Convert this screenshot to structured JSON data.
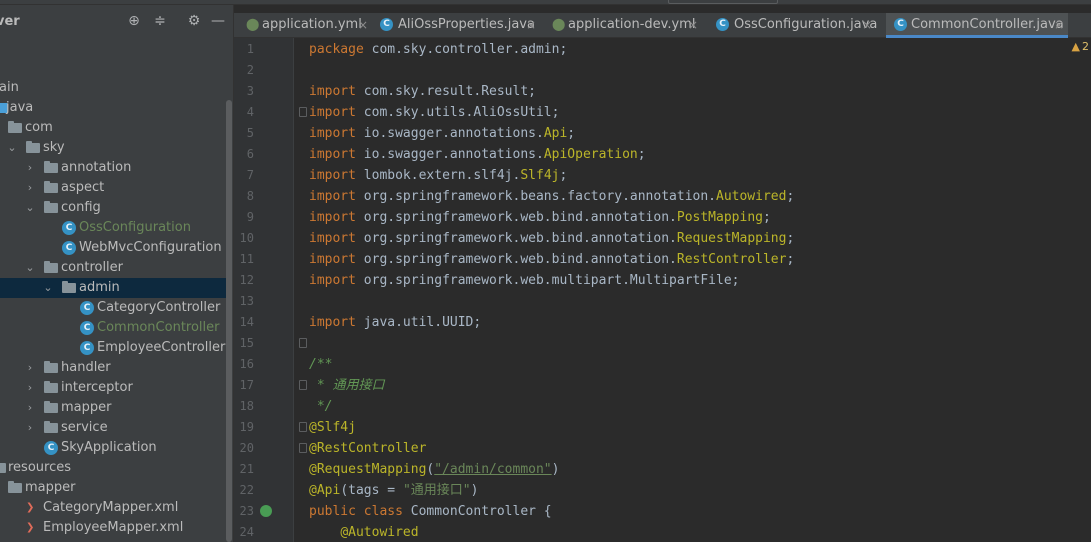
{
  "sidebar": {
    "title": "ver",
    "tree": [
      {
        "label": "ain"
      },
      {
        "label": "java"
      },
      {
        "label": "com"
      },
      {
        "label": "sky"
      },
      {
        "label": "annotation"
      },
      {
        "label": "aspect"
      },
      {
        "label": "config"
      },
      {
        "label": "OssConfiguration"
      },
      {
        "label": "WebMvcConfiguration"
      },
      {
        "label": "controller"
      },
      {
        "label": "admin"
      },
      {
        "label": "CategoryController"
      },
      {
        "label": "CommonController"
      },
      {
        "label": "EmployeeController"
      },
      {
        "label": "handler"
      },
      {
        "label": "interceptor"
      },
      {
        "label": "mapper"
      },
      {
        "label": "service"
      },
      {
        "label": "SkyApplication"
      },
      {
        "label": "resources"
      },
      {
        "label": "mapper"
      },
      {
        "label": "CategoryMapper.xml"
      },
      {
        "label": "EmployeeMapper.xml"
      }
    ]
  },
  "tabs": [
    {
      "label": "application.yml",
      "icon": "yml-icon"
    },
    {
      "label": "AliOssProperties.java",
      "icon": "class-icon"
    },
    {
      "label": "application-dev.yml",
      "icon": "yml-icon"
    },
    {
      "label": "OssConfiguration.java",
      "icon": "class-icon"
    },
    {
      "label": "CommonController.java",
      "icon": "class-icon",
      "active": true
    }
  ],
  "editor": {
    "warning_count": "2",
    "lines": [
      {
        "n": "1",
        "tokens": [
          [
            "kw",
            "package "
          ],
          [
            "p",
            "com.sky.controller.admin;"
          ]
        ]
      },
      {
        "n": "2",
        "tokens": []
      },
      {
        "n": "3",
        "tokens": [
          [
            "kw",
            "import "
          ],
          [
            "p",
            "com.sky.result.Result;"
          ]
        ]
      },
      {
        "n": "4",
        "tokens": [
          [
            "kw",
            "import "
          ],
          [
            "p",
            "com.sky.utils.AliOssUtil;"
          ]
        ]
      },
      {
        "n": "5",
        "tokens": [
          [
            "kw",
            "import "
          ],
          [
            "p",
            "io.swagger.annotations."
          ],
          [
            "ann",
            "Api"
          ],
          [
            "p",
            ";"
          ]
        ]
      },
      {
        "n": "6",
        "tokens": [
          [
            "kw",
            "import "
          ],
          [
            "p",
            "io.swagger.annotations."
          ],
          [
            "ann",
            "ApiOperation"
          ],
          [
            "p",
            ";"
          ]
        ]
      },
      {
        "n": "7",
        "tokens": [
          [
            "kw",
            "import "
          ],
          [
            "p",
            "lombok.extern.slf4j."
          ],
          [
            "ann",
            "Slf4j"
          ],
          [
            "p",
            ";"
          ]
        ]
      },
      {
        "n": "8",
        "tokens": [
          [
            "kw",
            "import "
          ],
          [
            "p",
            "org.springframework.beans.factory.annotation."
          ],
          [
            "ann",
            "Autowired"
          ],
          [
            "p",
            ";"
          ]
        ]
      },
      {
        "n": "9",
        "tokens": [
          [
            "kw",
            "import "
          ],
          [
            "p",
            "org.springframework.web.bind.annotation."
          ],
          [
            "ann",
            "PostMapping"
          ],
          [
            "p",
            ";"
          ]
        ]
      },
      {
        "n": "10",
        "tokens": [
          [
            "kw",
            "import "
          ],
          [
            "p",
            "org.springframework.web.bind.annotation."
          ],
          [
            "ann",
            "RequestMapping"
          ],
          [
            "p",
            ";"
          ]
        ]
      },
      {
        "n": "11",
        "tokens": [
          [
            "kw",
            "import "
          ],
          [
            "p",
            "org.springframework.web.bind.annotation."
          ],
          [
            "ann",
            "RestController"
          ],
          [
            "p",
            ";"
          ]
        ]
      },
      {
        "n": "12",
        "tokens": [
          [
            "kw",
            "import "
          ],
          [
            "p",
            "org.springframework.web.multipart.MultipartFile;"
          ]
        ]
      },
      {
        "n": "13",
        "tokens": []
      },
      {
        "n": "14",
        "tokens": [
          [
            "kw",
            "import "
          ],
          [
            "p",
            "java.util.UUID;"
          ]
        ]
      },
      {
        "n": "15",
        "tokens": []
      },
      {
        "n": "16",
        "tokens": [
          [
            "cm",
            "/**"
          ]
        ]
      },
      {
        "n": "17",
        "tokens": [
          [
            "cm",
            " * 通用接口"
          ]
        ]
      },
      {
        "n": "18",
        "tokens": [
          [
            "cm",
            " */"
          ]
        ]
      },
      {
        "n": "19",
        "tokens": [
          [
            "ann",
            "@Slf4j"
          ]
        ]
      },
      {
        "n": "20",
        "tokens": [
          [
            "ann",
            "@RestController"
          ]
        ]
      },
      {
        "n": "21",
        "tokens": [
          [
            "ann",
            "@RequestMapping"
          ],
          [
            "p",
            "("
          ],
          [
            "strl",
            "\"/admin/common\""
          ],
          [
            "p",
            ")"
          ]
        ]
      },
      {
        "n": "22",
        "tokens": [
          [
            "ann",
            "@Api"
          ],
          [
            "p",
            "(tags = "
          ],
          [
            "str",
            "\"通用接口\""
          ],
          [
            "p",
            ")"
          ]
        ]
      },
      {
        "n": "23",
        "tokens": [
          [
            "kw",
            "public class "
          ],
          [
            "p",
            "CommonController {"
          ]
        ]
      },
      {
        "n": "24",
        "tokens": [
          [
            "p",
            "    "
          ],
          [
            "ann",
            "@Autowired"
          ]
        ]
      }
    ]
  },
  "colors": {
    "keyword": "#cc7832",
    "annotation": "#bbb529",
    "string": "#6a8759",
    "comment": "#629755",
    "plain": "#a9b7c6",
    "modified_file": "#6a8759",
    "vcs_file": "#3e86a0",
    "accent": "#4a88c7"
  }
}
